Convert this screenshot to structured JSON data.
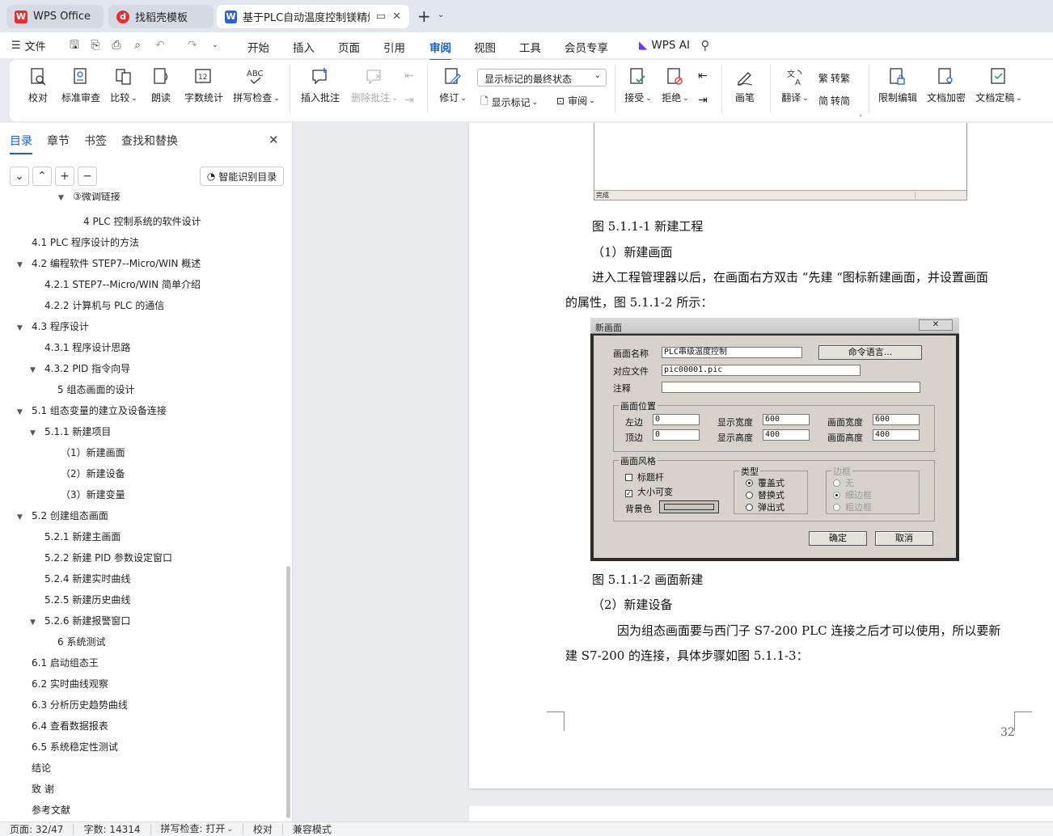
{
  "tabs": [
    {
      "label": "WPS Office"
    },
    {
      "label": "找稻壳模板"
    },
    {
      "label": "基于PLC自动温度控制镁精炼"
    }
  ],
  "menu": {
    "file": "文件",
    "items": [
      "开始",
      "插入",
      "页面",
      "引用",
      "审阅",
      "视图",
      "工具",
      "会员专享"
    ],
    "active": "审阅",
    "ai": "WPS AI"
  },
  "ribbon": {
    "proofread": "校对",
    "standard_review": "标准审查",
    "compare": "比较",
    "read_aloud": "朗读",
    "word_count": "字数统计",
    "spell_check": "拼写检查",
    "insert_comment": "插入批注",
    "delete_comment": "删除批注",
    "revise": "修订",
    "markup_select": "显示标记的最终状态",
    "show_markup": "显示标记",
    "review": "审阅",
    "accept": "接受",
    "reject": "拒绝",
    "pen": "画笔",
    "translate": "翻译",
    "to_traditional": "转繁",
    "to_simplified": "转简",
    "restrict_edit": "限制编辑",
    "encrypt": "文档加密",
    "finalize": "文档定稿"
  },
  "panel": {
    "tabs": [
      "目录",
      "章节",
      "书签",
      "查找和替换"
    ],
    "smart_btn": "智能识别目录",
    "toc": [
      {
        "text": "③微调链接",
        "arrow": true
      },
      {
        "text": "4 PLC 控制系统的软件设计",
        "arrow": false
      },
      {
        "text": "4.1 PLC 程序设计的方法",
        "arrow": false
      },
      {
        "text": "4.2 编程软件 STEP7--Micro/WIN 概述",
        "arrow": true
      },
      {
        "text": "4.2.1 STEP7--Micro/WIN 简单介绍",
        "arrow": false
      },
      {
        "text": "4.2.2 计算机与 PLC 的通信",
        "arrow": false
      },
      {
        "text": "4.3 程序设计",
        "arrow": true
      },
      {
        "text": "4.3.1 程序设计思路",
        "arrow": false
      },
      {
        "text": "4.3.2 PID 指令向导",
        "arrow": true
      },
      {
        "text": "5 组态画面的设计",
        "arrow": false
      },
      {
        "text": "5.1 组态变量的建立及设备连接",
        "arrow": true
      },
      {
        "text": "5.1.1 新建项目",
        "arrow": true
      },
      {
        "text": "（1）新建画面",
        "arrow": false
      },
      {
        "text": "（2）新建设备",
        "arrow": false
      },
      {
        "text": "（3）新建变量",
        "arrow": false
      },
      {
        "text": "5.2 创建组态画面",
        "arrow": true
      },
      {
        "text": "5.2.1 新建主画面",
        "arrow": false
      },
      {
        "text": "5.2.2 新建 PID 参数设定窗口",
        "arrow": false
      },
      {
        "text": "5.2.4 新建实时曲线",
        "arrow": false
      },
      {
        "text": "5.2.5 新建历史曲线",
        "arrow": false
      },
      {
        "text": "5.2.6 新建报警窗口",
        "arrow": true
      },
      {
        "text": "6 系统测试",
        "arrow": false
      },
      {
        "text": "6.1 启动组态王",
        "arrow": false
      },
      {
        "text": "6.2 实时曲线观察",
        "arrow": false
      },
      {
        "text": "6.3 分析历史趋势曲线",
        "arrow": false
      },
      {
        "text": "6.4 查看数据报表",
        "arrow": false
      },
      {
        "text": "6.5 系统稳定性测试",
        "arrow": false
      },
      {
        "text": "结论",
        "arrow": false
      },
      {
        "text": "致 谢",
        "arrow": false
      },
      {
        "text": "参考文献",
        "arrow": false
      }
    ]
  },
  "doc": {
    "fig1_status": "完成",
    "fig1_caption": "图 5.1.1-1 新建工程",
    "h1": "（1）新建画面",
    "p1a": "进入工程管理器以后，在画面右方双击 “先建 “图标新建画面，并设置画面",
    "p1b": "的属性，图 5.1.1-2 所示：",
    "fig2_caption": "图 5.1.1-2 画面新建",
    "h2": "（2）新建设备",
    "p2a": "因为组态画面要与西门子 S7-200 PLC 连接之后才可以使用，所以要新",
    "p2b": "建 S7-200 的连接，具体步骤如图 5.1.1-3：",
    "page_number": "32"
  },
  "dialog": {
    "title": "新画面",
    "name_label": "画面名称",
    "name_value": "PLC串级温度控制",
    "cmd_btn": "命令语言...",
    "file_label": "对应文件",
    "file_value": "pic00001.pic",
    "note_label": "注释",
    "note_value": "",
    "pos_group": "画面位置",
    "left_label": "左边",
    "left_value": "0",
    "top_label": "顶边",
    "top_value": "0",
    "disp_w_label": "显示宽度",
    "disp_w_value": "600",
    "disp_h_label": "显示高度",
    "disp_h_value": "400",
    "pic_w_label": "画面宽度",
    "pic_w_value": "600",
    "pic_h_label": "画面高度",
    "pic_h_value": "400",
    "style_group": "画面风格",
    "titlebar_label": "标题杆",
    "resizable_label": "大小可变",
    "bg_label": "背景色",
    "type_group": "类型",
    "type_overlay": "覆盖式",
    "type_replace": "替换式",
    "type_popup": "弹出式",
    "border_group": "边框",
    "border_none": "无",
    "border_thin": "细边框",
    "border_thick": "粗边框",
    "ok": "确定",
    "cancel": "取消"
  },
  "status": {
    "page": "页面: 32/47",
    "words": "字数: 14314",
    "spell": "拼写检查: 打开",
    "proof": "校对",
    "compat": "兼容模式"
  }
}
